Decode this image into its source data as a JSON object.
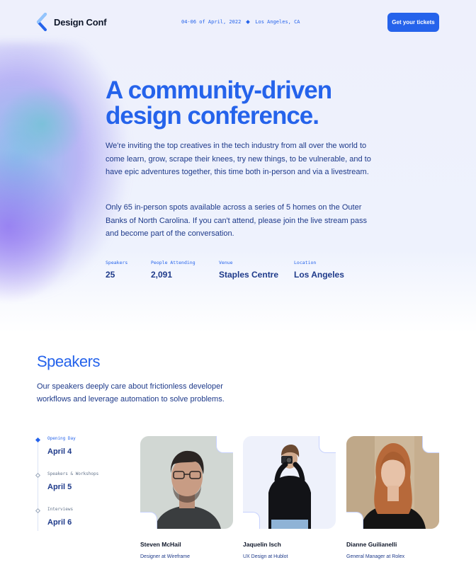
{
  "header": {
    "logo_text": "Design Conf",
    "dates": "04-06 of April, 2022",
    "location": "Los Angeles, CA",
    "cta_label": "Get your tickets"
  },
  "hero": {
    "title": "A community-driven design conference.",
    "paragraph1": "We're inviting the top creatives in the tech industry from all over the world to come learn, grow, scrape their knees, try new things, to be vulnerable, and to have epic adventures together, this time both in-person and via a livestream.",
    "paragraph2": "Only 65 in-person spots available across a series of 5 homes on the Outer Banks of North Carolina. If you can't attend, please join the live stream pass and become part of the conversation.",
    "stats": [
      {
        "label": "Speakers",
        "value": "25"
      },
      {
        "label": "People Attending",
        "value": "2,091"
      },
      {
        "label": "Venue",
        "value": "Staples Centre"
      },
      {
        "label": "Location",
        "value": "Los Angeles"
      }
    ]
  },
  "speakers": {
    "title": "Speakers",
    "description": "Our speakers deeply care about frictionless developer workflows and leverage automation to solve problems.",
    "days": [
      {
        "label": "Opening Day",
        "date": "April 4",
        "active": true
      },
      {
        "label": "Speakers & Workshops",
        "date": "April 5",
        "active": false
      },
      {
        "label": "Interviews",
        "date": "April 6",
        "active": false
      }
    ],
    "people": [
      {
        "name": "Steven McHail",
        "role": "Designer at Wireframe"
      },
      {
        "name": "Jaquelin Isch",
        "role": "UX Design at Hublot"
      },
      {
        "name": "Dianne Guilianelli",
        "role": "General Manager at Rolex"
      }
    ]
  },
  "colors": {
    "accent": "#2563eb",
    "heading_dark": "#1e3a8a"
  }
}
